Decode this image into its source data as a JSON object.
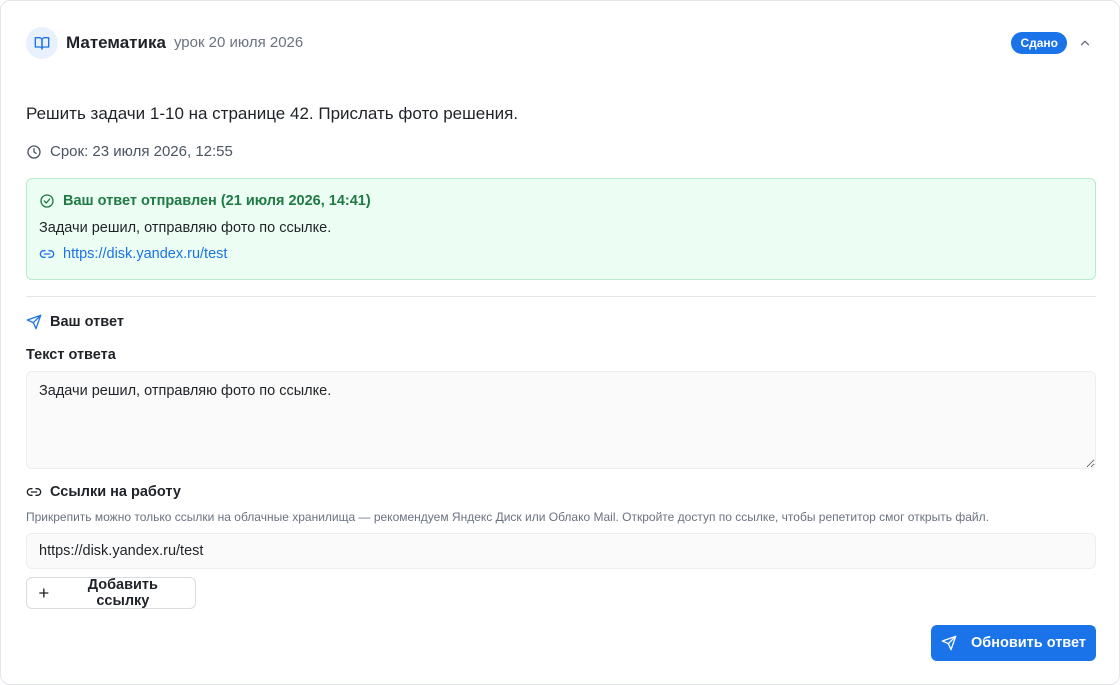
{
  "header": {
    "subject_icon": "book-open-icon",
    "subject": "Математика",
    "lesson_date": "урок 20 июля 2026",
    "status": "Сдано",
    "collapse_icon": "chevron-up-icon"
  },
  "task": {
    "description": "Решить задачи 1-10 на странице 42. Прислать фото решения.",
    "deadline_icon": "clock-icon",
    "deadline": "Срок: 23 июля 2026, 12:55"
  },
  "submitted": {
    "icon": "check-circle-icon",
    "title": "Ваш ответ отправлен (21 июля 2026, 14:41)",
    "text": "Задачи решил, отправляю фото по ссылке.",
    "link_icon": "link-icon",
    "link": "https://disk.yandex.ru/test"
  },
  "answer_form": {
    "section_icon": "send-icon",
    "section_title": "Ваш ответ",
    "text_label": "Текст ответа",
    "text_value": "Задачи решил, отправляю фото по ссылке.",
    "links_icon": "link-icon",
    "links_title": "Ссылки на работу",
    "links_hint": "Прикрепить можно только ссылки на облачные хранилища — рекомендуем Яндекс Диск или Облако Mail. Откройте доступ по ссылке, чтобы репетитор смог открыть файл.",
    "link_value": "https://disk.yandex.ru/test",
    "add_link_icon": "plus-icon",
    "add_link_label": "Добавить ссылку",
    "submit_icon": "send-icon",
    "submit_label": "Обновить ответ"
  },
  "colors": {
    "accent": "#1a73e8",
    "success_text": "#1f7a45",
    "success_bg": "#ecfdf3",
    "success_border": "#b7ebcd"
  }
}
